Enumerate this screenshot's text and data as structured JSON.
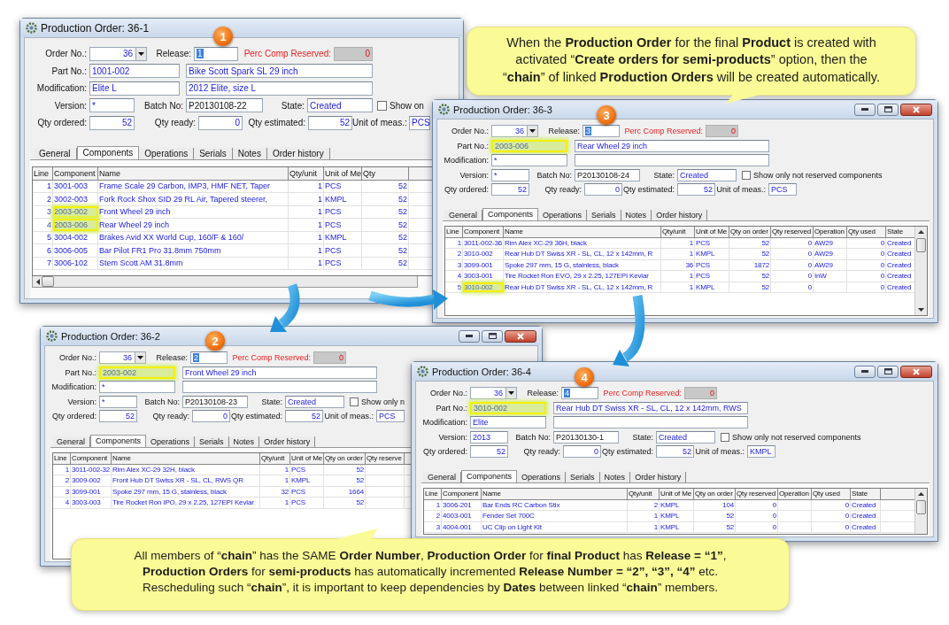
{
  "callouts": [
    {
      "lines": [
        "When the **Production Order** for the final **Product** is created with",
        "activated “**Create orders for semi-products**” option, then the",
        "“**chain**” of linked **Production Orders** will be created automatically."
      ]
    },
    {
      "lines": [
        "All members of “**chain**” has the SAME **Order Number**, **Production Order** for **final Product** has **Release = “1”**,",
        "**Production Orders** for **semi-products** has automatically incremented **Release Number = “2”, “3”, “4”** etc.",
        "Rescheduling such “**chain**”, it is important to keep dependencies by **Dates** between linked “**chain**” members."
      ]
    }
  ],
  "windows": [
    {
      "title": "Production Order: 36-1",
      "badge": "1",
      "form": [
        [
          {
            "kind": "label",
            "text": "Order No.:"
          },
          {
            "kind": "combo",
            "value": "36"
          },
          {
            "kind": "label",
            "text": "Release:"
          },
          {
            "kind": "release_field",
            "value": "1"
          },
          {
            "kind": "warning_label",
            "text": "Perc Comp Reserved:"
          },
          {
            "kind": "readonly_field",
            "value": "0"
          }
        ],
        [
          {
            "kind": "label",
            "text": "Part No.:"
          },
          {
            "kind": "text_field",
            "value": "1001-002",
            "highlighted": false
          },
          {
            "kind": "text_field",
            "value": "Bike Scott Spark SL 29 inch"
          }
        ],
        [
          {
            "kind": "label",
            "text": "Modification:"
          },
          {
            "kind": "text_field",
            "value": "Elite L"
          },
          {
            "kind": "text_field",
            "value": "2012 Elite, size L"
          }
        ],
        [
          {
            "kind": "label",
            "text": "Version:"
          },
          {
            "kind": "text_field",
            "value": "*"
          },
          {
            "kind": "label",
            "text": "Batch No:"
          },
          {
            "kind": "plain_field",
            "value": "P20130108-22"
          },
          {
            "kind": "label",
            "text": "State:"
          },
          {
            "kind": "text_field",
            "value": "Created"
          },
          {
            "kind": "checkbox",
            "checked": false,
            "label": "Show on"
          }
        ],
        [
          {
            "kind": "label",
            "text": "Qty ordered:"
          },
          {
            "kind": "number_field",
            "value": "52"
          },
          {
            "kind": "label",
            "text": "Qty ready:"
          },
          {
            "kind": "number_field",
            "value": "0"
          },
          {
            "kind": "label",
            "text": "Qty estimated:"
          },
          {
            "kind": "number_field",
            "value": "52"
          },
          {
            "kind": "label",
            "text": "Unit of meas.:"
          },
          {
            "kind": "text_field",
            "value": "PCS"
          }
        ]
      ],
      "tabs": [
        {
          "label": "General",
          "selected": false
        },
        {
          "label": "Components",
          "selected": true
        },
        {
          "label": "Operations",
          "selected": false
        },
        {
          "label": "Serials",
          "selected": false
        },
        {
          "label": "Notes",
          "selected": false
        },
        {
          "label": "Order history",
          "selected": false
        }
      ],
      "table": {
        "columns": [
          "Line",
          "Component",
          "Name",
          "Qty/unit",
          "Unit of Me",
          "Qty"
        ],
        "rows": [
          {
            "cells": [
              "1",
              "3001-003",
              "Frame Scale 29 Carbon, IMP3, HMF NET, Taper",
              "1",
              "PCS",
              "52"
            ],
            "highlighted": false
          },
          {
            "cells": [
              "2",
              "3002-003",
              "Fork Rock Shox SID 29 RL Air, Tapered steerer,",
              "1",
              "KMPL",
              "52"
            ],
            "highlighted": false
          },
          {
            "cells": [
              "3",
              "2003-002",
              "Front Wheel 29 inch",
              "1",
              "PCS",
              "52"
            ],
            "highlighted": true
          },
          {
            "cells": [
              "4",
              "2003-006",
              "Rear Wheel 29 inch",
              "1",
              "PCS",
              "52"
            ],
            "highlighted": true
          },
          {
            "cells": [
              "5",
              "3004-002",
              "Brakes Avid XX World Cup, 160/F & 160/",
              "1",
              "KMPL",
              "52"
            ],
            "highlighted": false
          },
          {
            "cells": [
              "6",
              "3006-005",
              "Bar Pilot FR1 Pro 31.8mm 750mm",
              "1",
              "PCS",
              "52"
            ],
            "highlighted": false
          },
          {
            "cells": [
              "7",
              "3006-102",
              "Stem Scott AM 31.8mm",
              "1",
              "PCS",
              "52"
            ],
            "highlighted": false
          }
        ]
      }
    },
    {
      "title": "Production Order: 36-2",
      "badge": "2",
      "form": [
        [
          {
            "kind": "label",
            "text": "Order No.:"
          },
          {
            "kind": "combo",
            "value": "36"
          },
          {
            "kind": "label",
            "text": "Release:"
          },
          {
            "kind": "release_field",
            "value": "2"
          },
          {
            "kind": "warning_label",
            "text": "Perc Comp Reserved:"
          },
          {
            "kind": "readonly_field",
            "value": "0"
          }
        ],
        [
          {
            "kind": "label",
            "text": "Part No.:"
          },
          {
            "kind": "text_field",
            "value": "2003-002",
            "highlighted": true
          },
          {
            "kind": "text_field",
            "value": "Front Wheel 29 inch"
          }
        ],
        [
          {
            "kind": "label",
            "text": "Modification:"
          },
          {
            "kind": "text_field",
            "value": "*"
          },
          {
            "kind": "text_field"
          }
        ],
        [
          {
            "kind": "label",
            "text": "Version:"
          },
          {
            "kind": "text_field",
            "value": "*"
          },
          {
            "kind": "label",
            "text": "Batch No:"
          },
          {
            "kind": "plain_field",
            "value": "P20130108-23"
          },
          {
            "kind": "label",
            "text": "State:"
          },
          {
            "kind": "text_field",
            "value": "Created"
          },
          {
            "kind": "checkbox",
            "checked": false,
            "label": "Show only n"
          }
        ],
        [
          {
            "kind": "label",
            "text": "Qty ordered:"
          },
          {
            "kind": "number_field",
            "value": "52"
          },
          {
            "kind": "label",
            "text": "Qty ready:"
          },
          {
            "kind": "number_field",
            "value": "0"
          },
          {
            "kind": "label",
            "text": "Qty estimated:"
          },
          {
            "kind": "number_field",
            "value": "52"
          },
          {
            "kind": "label",
            "text": "Unit of meas.:"
          },
          {
            "kind": "text_field",
            "value": "PCS"
          }
        ]
      ],
      "tabs": [
        {
          "label": "General",
          "selected": false
        },
        {
          "label": "Components",
          "selected": true
        },
        {
          "label": "Operations",
          "selected": false
        },
        {
          "label": "Serials",
          "selected": false
        },
        {
          "label": "Notes",
          "selected": false
        },
        {
          "label": "Order history",
          "selected": false
        }
      ],
      "table": {
        "columns": [
          "Line",
          "Component",
          "Name",
          "Qty/unit",
          "Unit of Me",
          "Qty on order",
          "Qty reserve"
        ],
        "rows": [
          {
            "cells": [
              "1",
              "3011-002-32",
              "Rim Alex XC-29 32H, black",
              "1",
              "PCS",
              "52"
            ],
            "highlighted": false
          },
          {
            "cells": [
              "2",
              "3009-002",
              "Front Hub DT Swiss XR - SL, CL, RWS QR",
              "1",
              "KMPL",
              "52"
            ],
            "highlighted": false
          },
          {
            "cells": [
              "3",
              "3099-001",
              "Spoke 297 mm, 15 G, stainless, black",
              "32",
              "PCS",
              "1664"
            ],
            "highlighted": false
          },
          {
            "cells": [
              "4",
              "3003-003",
              "Tire Rocket Ron IPO, 29 x 2.25, 127EPI Kevlar",
              "1",
              "PCS",
              "52"
            ],
            "highlighted": false
          }
        ]
      }
    },
    {
      "title": "Production Order: 36-3",
      "badge": "3",
      "form": [
        [
          {
            "kind": "label",
            "text": "Order No.:"
          },
          {
            "kind": "combo",
            "value": "36"
          },
          {
            "kind": "label",
            "text": "Release:"
          },
          {
            "kind": "release_field",
            "value": "3"
          },
          {
            "kind": "warning_label",
            "text": "Perc Comp Reserved:"
          },
          {
            "kind": "readonly_field",
            "value": "0"
          }
        ],
        [
          {
            "kind": "label",
            "text": "Part No.:"
          },
          {
            "kind": "text_field",
            "value": "2003-006",
            "highlighted": true
          },
          {
            "kind": "text_field",
            "value": "Rear Wheel 29 inch"
          }
        ],
        [
          {
            "kind": "label",
            "text": "Modification:"
          },
          {
            "kind": "text_field",
            "value": "*"
          },
          {
            "kind": "text_field"
          }
        ],
        [
          {
            "kind": "label",
            "text": "Version:"
          },
          {
            "kind": "text_field",
            "value": "*"
          },
          {
            "kind": "label",
            "text": "Batch No:"
          },
          {
            "kind": "plain_field",
            "value": "P20130108-24"
          },
          {
            "kind": "label",
            "text": "State:"
          },
          {
            "kind": "text_field",
            "value": "Created"
          },
          {
            "kind": "checkbox",
            "checked": false,
            "label": "Show only not reserved components"
          }
        ],
        [
          {
            "kind": "label",
            "text": "Qty ordered:"
          },
          {
            "kind": "number_field",
            "value": "52"
          },
          {
            "kind": "label",
            "text": "Qty ready:"
          },
          {
            "kind": "number_field",
            "value": "0"
          },
          {
            "kind": "label",
            "text": "Qty estimated:"
          },
          {
            "kind": "number_field",
            "value": "52"
          },
          {
            "kind": "label",
            "text": "Unit of meas.:"
          },
          {
            "kind": "text_field",
            "value": "PCS"
          }
        ]
      ],
      "tabs": [
        {
          "label": "General",
          "selected": false
        },
        {
          "label": "Components",
          "selected": true
        },
        {
          "label": "Operations",
          "selected": false
        },
        {
          "label": "Serials",
          "selected": false
        },
        {
          "label": "Notes",
          "selected": false
        },
        {
          "label": "Order history",
          "selected": false
        }
      ],
      "table": {
        "columns": [
          "Line",
          "Component",
          "Name",
          "Qty/unit",
          "Unit of Me",
          "Qty on order",
          "Qty reserved",
          "Operation",
          "Qty used",
          "State"
        ],
        "rows": [
          {
            "cells": [
              "1",
              "3011-002-36",
              "Rim Alex XC-29 36H, black",
              "1",
              "PCS",
              "52",
              "0",
              "AW29",
              "0",
              "Created"
            ],
            "highlighted": false
          },
          {
            "cells": [
              "2",
              "3010-002",
              "Rear Hub DT Swiss XR - SL, CL, 12 x 142mm, R",
              "1",
              "KMPL",
              "52",
              "0",
              "AW29",
              "0",
              "Created"
            ],
            "highlighted": false
          },
          {
            "cells": [
              "3",
              "3099-001",
              "Spoke 297 mm, 15 G, stainless, black",
              "36",
              "PCS",
              "1872",
              "0",
              "AW29",
              "0",
              "Created"
            ],
            "highlighted": false
          },
          {
            "cells": [
              "4",
              "3003-001",
              "Tire Rocket Ron EVO, 29 x 2.25, 127EPI Kevlar",
              "1",
              "PCS",
              "52",
              "0",
              "InW",
              "0",
              "Created"
            ],
            "highlighted": false
          },
          {
            "cells": [
              "5",
              "3010-002",
              "Rear Hub DT Swiss XR - SL, CL, 12 x 142mm, R",
              "1",
              "KMPL",
              "52",
              "0",
              null,
              "0",
              "Created"
            ],
            "highlighted": true
          }
        ]
      }
    },
    {
      "title": "Production Order: 36-4",
      "badge": "4",
      "form": [
        [
          {
            "kind": "label",
            "text": "Order No.:"
          },
          {
            "kind": "combo",
            "value": "36"
          },
          {
            "kind": "label",
            "text": "Release:"
          },
          {
            "kind": "release_field",
            "value": "4"
          },
          {
            "kind": "warning_label",
            "text": "Perc Comp Reserved:"
          },
          {
            "kind": "readonly_field",
            "value": "0"
          }
        ],
        [
          {
            "kind": "label",
            "text": "Part No.:"
          },
          {
            "kind": "text_field",
            "value": "3010-002",
            "highlighted": true
          },
          {
            "kind": "text_field",
            "value": "Rear Hub DT Swiss XR - SL, CL, 12 x 142mm, RWS"
          }
        ],
        [
          {
            "kind": "label",
            "text": "Modification:"
          },
          {
            "kind": "text_field",
            "value": "Elite"
          },
          {
            "kind": "text_field"
          }
        ],
        [
          {
            "kind": "label",
            "text": "Version:"
          },
          {
            "kind": "text_field",
            "value": "2013"
          },
          {
            "kind": "label",
            "text": "Batch No:"
          },
          {
            "kind": "plain_field",
            "value": "P20130130-1"
          },
          {
            "kind": "label",
            "text": "State:"
          },
          {
            "kind": "text_field",
            "value": "Created"
          },
          {
            "kind": "checkbox",
            "checked": false,
            "label": "Show only not reserved components"
          }
        ],
        [
          {
            "kind": "label",
            "text": "Qty ordered:"
          },
          {
            "kind": "number_field",
            "value": "52"
          },
          {
            "kind": "label",
            "text": "Qty ready:"
          },
          {
            "kind": "number_field",
            "value": "0"
          },
          {
            "kind": "label",
            "text": "Qty estimated:"
          },
          {
            "kind": "number_field",
            "value": "52"
          },
          {
            "kind": "label",
            "text": "Unit of meas.:"
          },
          {
            "kind": "text_field",
            "value": "KMPL"
          }
        ]
      ],
      "tabs": [
        {
          "label": "General",
          "selected": false
        },
        {
          "label": "Components",
          "selected": true
        },
        {
          "label": "Operations",
          "selected": false
        },
        {
          "label": "Serials",
          "selected": false
        },
        {
          "label": "Notes",
          "selected": false
        },
        {
          "label": "Order history",
          "selected": false
        }
      ],
      "table": {
        "columns": [
          "Line",
          "Component",
          "Name",
          "Qty/unit",
          "Unit of Me",
          "Qty on order",
          "Qty reserved",
          "Operation",
          "Qty used",
          "State"
        ],
        "rows": [
          {
            "cells": [
              "1",
              "3006-201",
              "Bar Ends RC Carbon Stix",
              "2",
              "KMPL",
              "104",
              "0",
              null,
              "0",
              "Created"
            ],
            "highlighted": false
          },
          {
            "cells": [
              "2",
              "4003-001",
              "Fender Set 700C",
              "1",
              "KMPL",
              "52",
              "0",
              null,
              "0",
              "Created"
            ],
            "highlighted": false
          },
          {
            "cells": [
              "3",
              "4004-001",
              "UC Clip on Light Kit",
              "1",
              "KMPL",
              "52",
              "0",
              null,
              "0",
              "Created"
            ],
            "highlighted": false
          }
        ]
      }
    }
  ]
}
